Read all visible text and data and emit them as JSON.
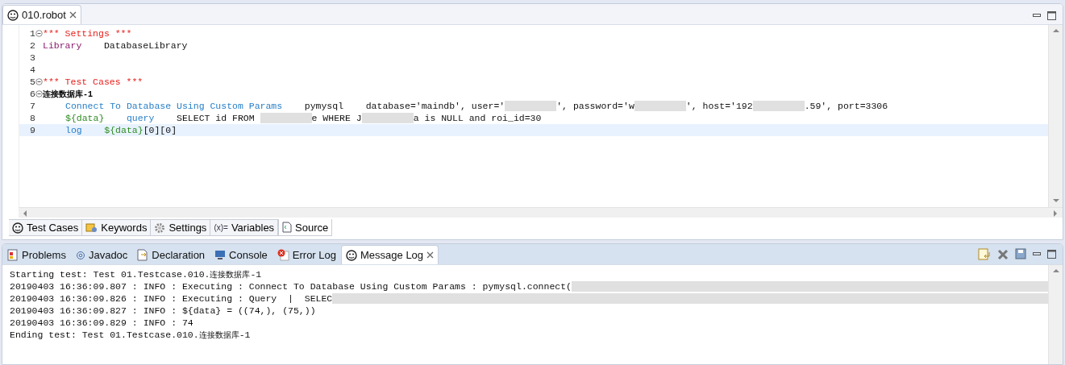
{
  "editor": {
    "tab": {
      "title": "010.robot",
      "selected": true
    },
    "lines": [
      {
        "number": "1",
        "foldable": true,
        "current": false,
        "indented": false,
        "segments": [
          {
            "kind": "section",
            "text": "*** Settings ***"
          }
        ]
      },
      {
        "number": "2",
        "foldable": false,
        "current": false,
        "indented": false,
        "segments": [
          {
            "kind": "setting",
            "text": "Library"
          },
          {
            "kind": "plain",
            "text": "    DatabaseLibrary"
          }
        ]
      },
      {
        "number": "3",
        "foldable": false,
        "current": false
      },
      {
        "number": "4",
        "foldable": false,
        "current": false
      },
      {
        "number": "5",
        "foldable": true,
        "current": false,
        "indented": false,
        "segments": [
          {
            "kind": "section",
            "text": "*** Test Cases ***"
          }
        ]
      },
      {
        "number": "6",
        "foldable": true,
        "current": false,
        "indented": false,
        "segments": [
          {
            "kind": "testname",
            "text": "连接数据库-1"
          }
        ]
      },
      {
        "number": "7",
        "foldable": false,
        "current": false,
        "indented": true,
        "segments": [
          {
            "kind": "keyword",
            "text": "Connect To Database Using Custom Params"
          },
          {
            "kind": "plain",
            "text": "    pymysql    database='maindb', user='"
          },
          {
            "kind": "redacted"
          },
          {
            "kind": "plain",
            "text": "', password='w"
          },
          {
            "kind": "redacted"
          },
          {
            "kind": "plain",
            "text": "', host='192"
          },
          {
            "kind": "redacted"
          },
          {
            "kind": "plain",
            "text": ".59', port=3306"
          }
        ]
      },
      {
        "number": "8",
        "foldable": false,
        "current": false,
        "indented": true,
        "segments": [
          {
            "kind": "variable",
            "text": "${data}"
          },
          {
            "kind": "keyword",
            "text": "query"
          },
          {
            "kind": "plain",
            "text": "    SELECT id FROM "
          },
          {
            "kind": "redacted"
          },
          {
            "kind": "plain",
            "text": "e WHERE J"
          },
          {
            "kind": "redacted"
          },
          {
            "kind": "plain",
            "text": "a is NULL and roi_id=30"
          }
        ]
      },
      {
        "number": "9",
        "foldable": false,
        "current": true,
        "indented": true,
        "segments": [
          {
            "kind": "keyword",
            "text": "log"
          },
          {
            "kind": "variable",
            "text": "${data}"
          },
          {
            "kind": "plain",
            "text": "[0][0]"
          }
        ]
      }
    ]
  },
  "editor_tabs": [
    {
      "label": "Test Cases",
      "selected": false
    },
    {
      "label": "Keywords",
      "selected": false
    },
    {
      "label": "Settings",
      "selected": false
    },
    {
      "label": "Variables",
      "icon_text": "(x)=",
      "selected": false
    },
    {
      "label": "Source",
      "selected": true
    }
  ],
  "panel_tabs": [
    {
      "label": "Problems",
      "selected": false,
      "closable": false
    },
    {
      "label": "Javadoc",
      "selected": false,
      "closable": false
    },
    {
      "label": "Declaration",
      "selected": false,
      "closable": false
    },
    {
      "label": "Console",
      "selected": false,
      "closable": false
    },
    {
      "label": "Error Log",
      "selected": false,
      "closable": false
    },
    {
      "label": "Message Log",
      "selected": true,
      "closable": true
    }
  ],
  "log_lines": [
    {
      "segments": [
        {
          "kind": "plain",
          "text": "Starting test: Test 01.Testcase.010."
        },
        {
          "kind": "cjk",
          "text": "连接数据库"
        },
        {
          "kind": "plain",
          "text": "-1"
        }
      ]
    },
    {
      "segments": [
        {
          "kind": "plain",
          "text": "20190403 16:36:09.807 : INFO : Executing : Connect To Database Using Custom Params : pymysql.connect("
        },
        {
          "kind": "redacted"
        }
      ]
    },
    {
      "segments": [
        {
          "kind": "plain",
          "text": "20190403 16:36:09.826 : INFO : Executing : Query  |  SELEC"
        },
        {
          "kind": "redacted"
        }
      ]
    },
    {
      "segments": [
        {
          "kind": "plain",
          "text": "20190403 16:36:09.827 : INFO : ${data} = ((74,), (75,))"
        }
      ]
    },
    {
      "segments": [
        {
          "kind": "plain",
          "text": "20190403 16:36:09.829 : INFO : 74"
        }
      ]
    },
    {
      "segments": [
        {
          "kind": "plain",
          "text": "Ending test: Test 01.Testcase.010."
        },
        {
          "kind": "cjk",
          "text": "连接数据库"
        },
        {
          "kind": "plain",
          "text": "-1"
        }
      ]
    }
  ]
}
